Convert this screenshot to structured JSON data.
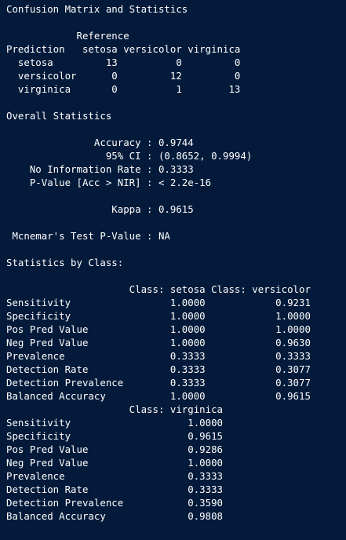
{
  "console": {
    "lines": [
      "Confusion Matrix and Statistics",
      "",
      "            Reference",
      "Prediction   setosa versicolor virginica",
      "  setosa         13          0         0",
      "  versicolor      0         12         0",
      "  virginica       0          1        13",
      "",
      "Overall Statistics",
      "",
      "               Accuracy : 0.9744",
      "                 95% CI : (0.8652, 0.9994)",
      "    No Information Rate : 0.3333",
      "    P-Value [Acc > NIR] : < 2.2e-16",
      "",
      "                  Kappa : 0.9615",
      "",
      " Mcnemar's Test P-Value : NA",
      "",
      "Statistics by Class:",
      "",
      "                     Class: setosa Class: versicolor",
      "Sensitivity                 1.0000            0.9231",
      "Specificity                 1.0000            1.0000",
      "Pos Pred Value              1.0000            1.0000",
      "Neg Pred Value              1.0000            0.9630",
      "Prevalence                  0.3333            0.3333",
      "Detection Rate              0.3333            0.3077",
      "Detection Prevalence        0.3333            0.3077",
      "Balanced Accuracy           1.0000            0.9615",
      "                     Class: virginica",
      "Sensitivity                    1.0000",
      "Specificity                    0.9615",
      "Pos Pred Value                 0.9286",
      "Neg Pred Value                 1.0000",
      "Prevalence                     0.3333",
      "Detection Rate                 0.3333",
      "Detection Prevalence           0.3590",
      "Balanced Accuracy              0.9808"
    ]
  },
  "colors": {
    "background": "#041a3a",
    "text": "#ffffff"
  }
}
